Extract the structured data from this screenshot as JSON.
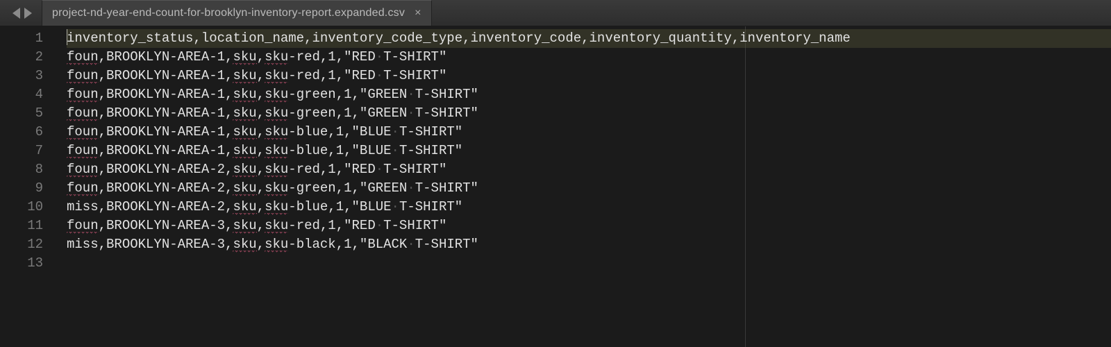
{
  "tab": {
    "filename": "project-nd-year-end-count-for-brooklyn-inventory-report.expanded.csv"
  },
  "editor": {
    "ruler_column": 88,
    "active_line": 1,
    "lines": [
      {
        "n": 1,
        "segs": [
          {
            "t": "inventory_status,location_name,inventory_code_type,inventory_code,inventory_quantity,inventory_name"
          }
        ]
      },
      {
        "n": 2,
        "segs": [
          {
            "t": "foun",
            "sq": true
          },
          {
            "t": ",BROOKLYN-AREA-1,"
          },
          {
            "t": "sku",
            "sq": true
          },
          {
            "t": ","
          },
          {
            "t": "sku",
            "sq": true
          },
          {
            "t": "-red,1,\"RED"
          },
          {
            "t": "·",
            "ws": true
          },
          {
            "t": "T-SHIRT\""
          }
        ]
      },
      {
        "n": 3,
        "segs": [
          {
            "t": "foun",
            "sq": true
          },
          {
            "t": ",BROOKLYN-AREA-1,"
          },
          {
            "t": "sku",
            "sq": true
          },
          {
            "t": ","
          },
          {
            "t": "sku",
            "sq": true
          },
          {
            "t": "-red,1,\"RED"
          },
          {
            "t": "·",
            "ws": true
          },
          {
            "t": "T-SHIRT\""
          }
        ]
      },
      {
        "n": 4,
        "segs": [
          {
            "t": "foun",
            "sq": true
          },
          {
            "t": ",BROOKLYN-AREA-1,"
          },
          {
            "t": "sku",
            "sq": true
          },
          {
            "t": ","
          },
          {
            "t": "sku",
            "sq": true
          },
          {
            "t": "-green,1,\"GREEN"
          },
          {
            "t": "·",
            "ws": true
          },
          {
            "t": "T-SHIRT\""
          }
        ]
      },
      {
        "n": 5,
        "segs": [
          {
            "t": "foun",
            "sq": true
          },
          {
            "t": ",BROOKLYN-AREA-1,"
          },
          {
            "t": "sku",
            "sq": true
          },
          {
            "t": ","
          },
          {
            "t": "sku",
            "sq": true
          },
          {
            "t": "-green,1,\"GREEN"
          },
          {
            "t": "·",
            "ws": true
          },
          {
            "t": "T-SHIRT\""
          }
        ]
      },
      {
        "n": 6,
        "segs": [
          {
            "t": "foun",
            "sq": true
          },
          {
            "t": ",BROOKLYN-AREA-1,"
          },
          {
            "t": "sku",
            "sq": true
          },
          {
            "t": ","
          },
          {
            "t": "sku",
            "sq": true
          },
          {
            "t": "-blue,1,\"BLUE"
          },
          {
            "t": "·",
            "ws": true
          },
          {
            "t": "T-SHIRT\""
          }
        ]
      },
      {
        "n": 7,
        "segs": [
          {
            "t": "foun",
            "sq": true
          },
          {
            "t": ",BROOKLYN-AREA-1,"
          },
          {
            "t": "sku",
            "sq": true
          },
          {
            "t": ","
          },
          {
            "t": "sku",
            "sq": true
          },
          {
            "t": "-blue,1,\"BLUE"
          },
          {
            "t": "·",
            "ws": true
          },
          {
            "t": "T-SHIRT\""
          }
        ]
      },
      {
        "n": 8,
        "segs": [
          {
            "t": "foun",
            "sq": true
          },
          {
            "t": ",BROOKLYN-AREA-2,"
          },
          {
            "t": "sku",
            "sq": true
          },
          {
            "t": ","
          },
          {
            "t": "sku",
            "sq": true
          },
          {
            "t": "-red,1,\"RED"
          },
          {
            "t": "·",
            "ws": true
          },
          {
            "t": "T-SHIRT\""
          }
        ]
      },
      {
        "n": 9,
        "segs": [
          {
            "t": "foun",
            "sq": true
          },
          {
            "t": ",BROOKLYN-AREA-2,"
          },
          {
            "t": "sku",
            "sq": true
          },
          {
            "t": ","
          },
          {
            "t": "sku",
            "sq": true
          },
          {
            "t": "-green,1,\"GREEN"
          },
          {
            "t": "·",
            "ws": true
          },
          {
            "t": "T-SHIRT\""
          }
        ]
      },
      {
        "n": 10,
        "segs": [
          {
            "t": "miss,BROOKLYN-AREA-2,"
          },
          {
            "t": "sku",
            "sq": true
          },
          {
            "t": ","
          },
          {
            "t": "sku",
            "sq": true
          },
          {
            "t": "-blue,1,\"BLUE"
          },
          {
            "t": "·",
            "ws": true
          },
          {
            "t": "T-SHIRT\""
          }
        ]
      },
      {
        "n": 11,
        "segs": [
          {
            "t": "foun",
            "sq": true
          },
          {
            "t": ",BROOKLYN-AREA-3,"
          },
          {
            "t": "sku",
            "sq": true
          },
          {
            "t": ","
          },
          {
            "t": "sku",
            "sq": true
          },
          {
            "t": "-red,1,\"RED"
          },
          {
            "t": "·",
            "ws": true
          },
          {
            "t": "T-SHIRT\""
          }
        ]
      },
      {
        "n": 12,
        "segs": [
          {
            "t": "miss,BROOKLYN-AREA-3,"
          },
          {
            "t": "sku",
            "sq": true
          },
          {
            "t": ","
          },
          {
            "t": "sku",
            "sq": true
          },
          {
            "t": "-black,1,\"BLACK"
          },
          {
            "t": "·",
            "ws": true
          },
          {
            "t": "T-SHIRT\""
          }
        ]
      },
      {
        "n": 13,
        "segs": [
          {
            "t": ""
          }
        ]
      }
    ]
  }
}
